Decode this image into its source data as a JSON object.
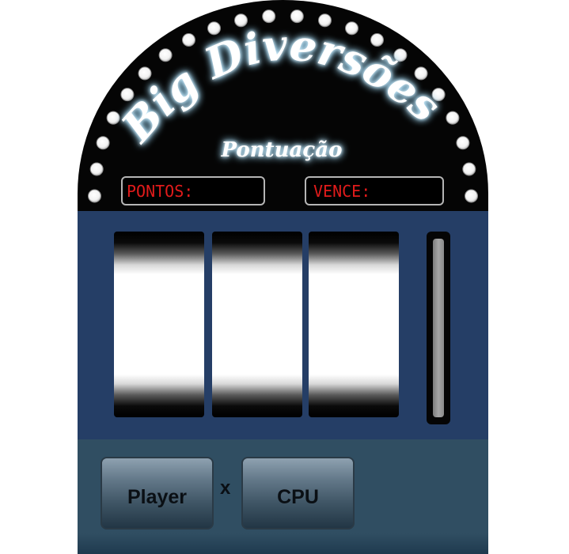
{
  "title": "Big Diversões",
  "subtitle": "Pontuação",
  "score_panel": {
    "points_label": "PONTOS:",
    "wins_label": "VENCE:"
  },
  "reels": [
    {
      "symbol": ""
    },
    {
      "symbol": ""
    },
    {
      "symbol": ""
    }
  ],
  "controls": {
    "player_label": "Player",
    "versus_label": "x",
    "cpu_label": "CPU"
  },
  "colors": {
    "arch": "#050505",
    "reel_panel": "#253e66",
    "control_panel": "#304e62",
    "neon_glow": "#9fd8f5",
    "led_text": "#e21b1b",
    "marquee_bulb": "#ffffff"
  },
  "icons": {
    "marquee": "light-bulb-icon",
    "lever": "lever-icon"
  }
}
